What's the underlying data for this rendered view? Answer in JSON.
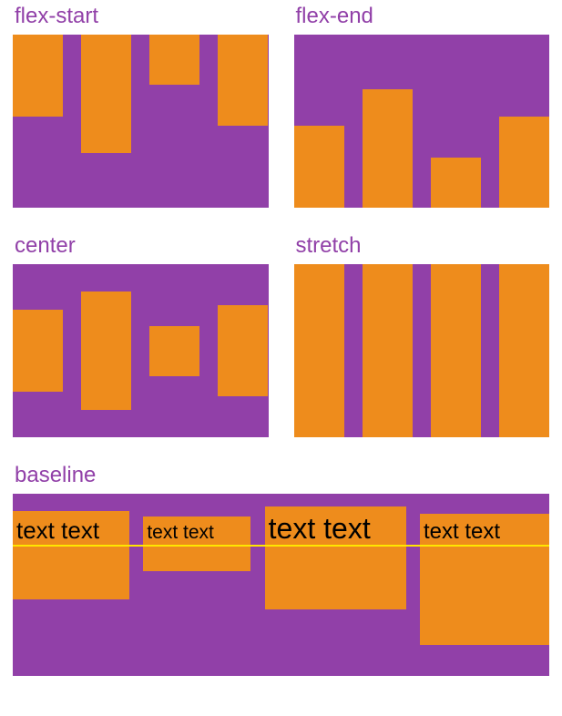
{
  "examples": {
    "flexStart": {
      "label": "flex-start"
    },
    "flexEnd": {
      "label": "flex-end"
    },
    "center": {
      "label": "center"
    },
    "stretch": {
      "label": "stretch"
    },
    "baseline": {
      "label": "baseline"
    }
  },
  "baselineItems": {
    "item1": "text text",
    "item2": "text text",
    "item3": "text text",
    "item4": "text text"
  },
  "colors": {
    "stage": "#9140a8",
    "box": "#ee8c1c",
    "line": "#ffe600"
  }
}
